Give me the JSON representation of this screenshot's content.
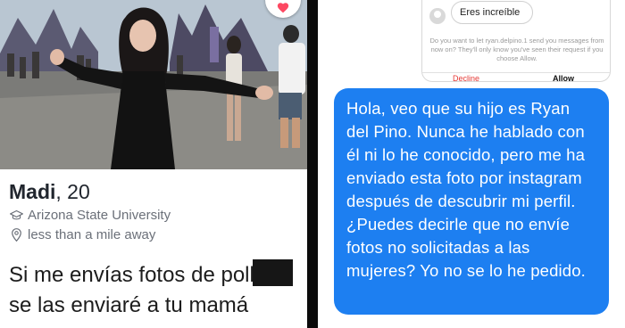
{
  "profile": {
    "name": "Madi",
    "age_text": ", 20",
    "school": "Arizona State University",
    "distance": "less than a mile away",
    "bio_line1": "Si me envías fotos de p",
    "bio_line1_tail": "ollas",
    "bio_line2": "se las enviaré a tu mamá",
    "icons": {
      "like": "heart-icon",
      "school": "graduation-cap-icon",
      "distance": "location-pin-icon"
    },
    "colors": {
      "like": "#fd4862",
      "text": "#21262e",
      "secondary": "#6b7079"
    }
  },
  "message_request": {
    "incoming_message": "Eres increíble",
    "prompt": "Do you want to let ryan.delpino.1 send you messages from now on? They'll only know you've seen their request if you choose Allow.",
    "decline_label": "Decline",
    "allow_label": "Allow",
    "colors": {
      "decline": "#e53935"
    }
  },
  "reply": {
    "text": "Hola, veo que su hijo es Ryan del Pino. Nunca he hablado con él ni lo he conocido, pero me ha enviado esta foto por instagram después de descubrir mi perfil. ¿Puedes decirle que no envíe fotos no solicitadas a las mujeres? Yo no se lo he pedido.",
    "colors": {
      "bubble": "#1d7ff1",
      "text": "#ffffff"
    }
  }
}
